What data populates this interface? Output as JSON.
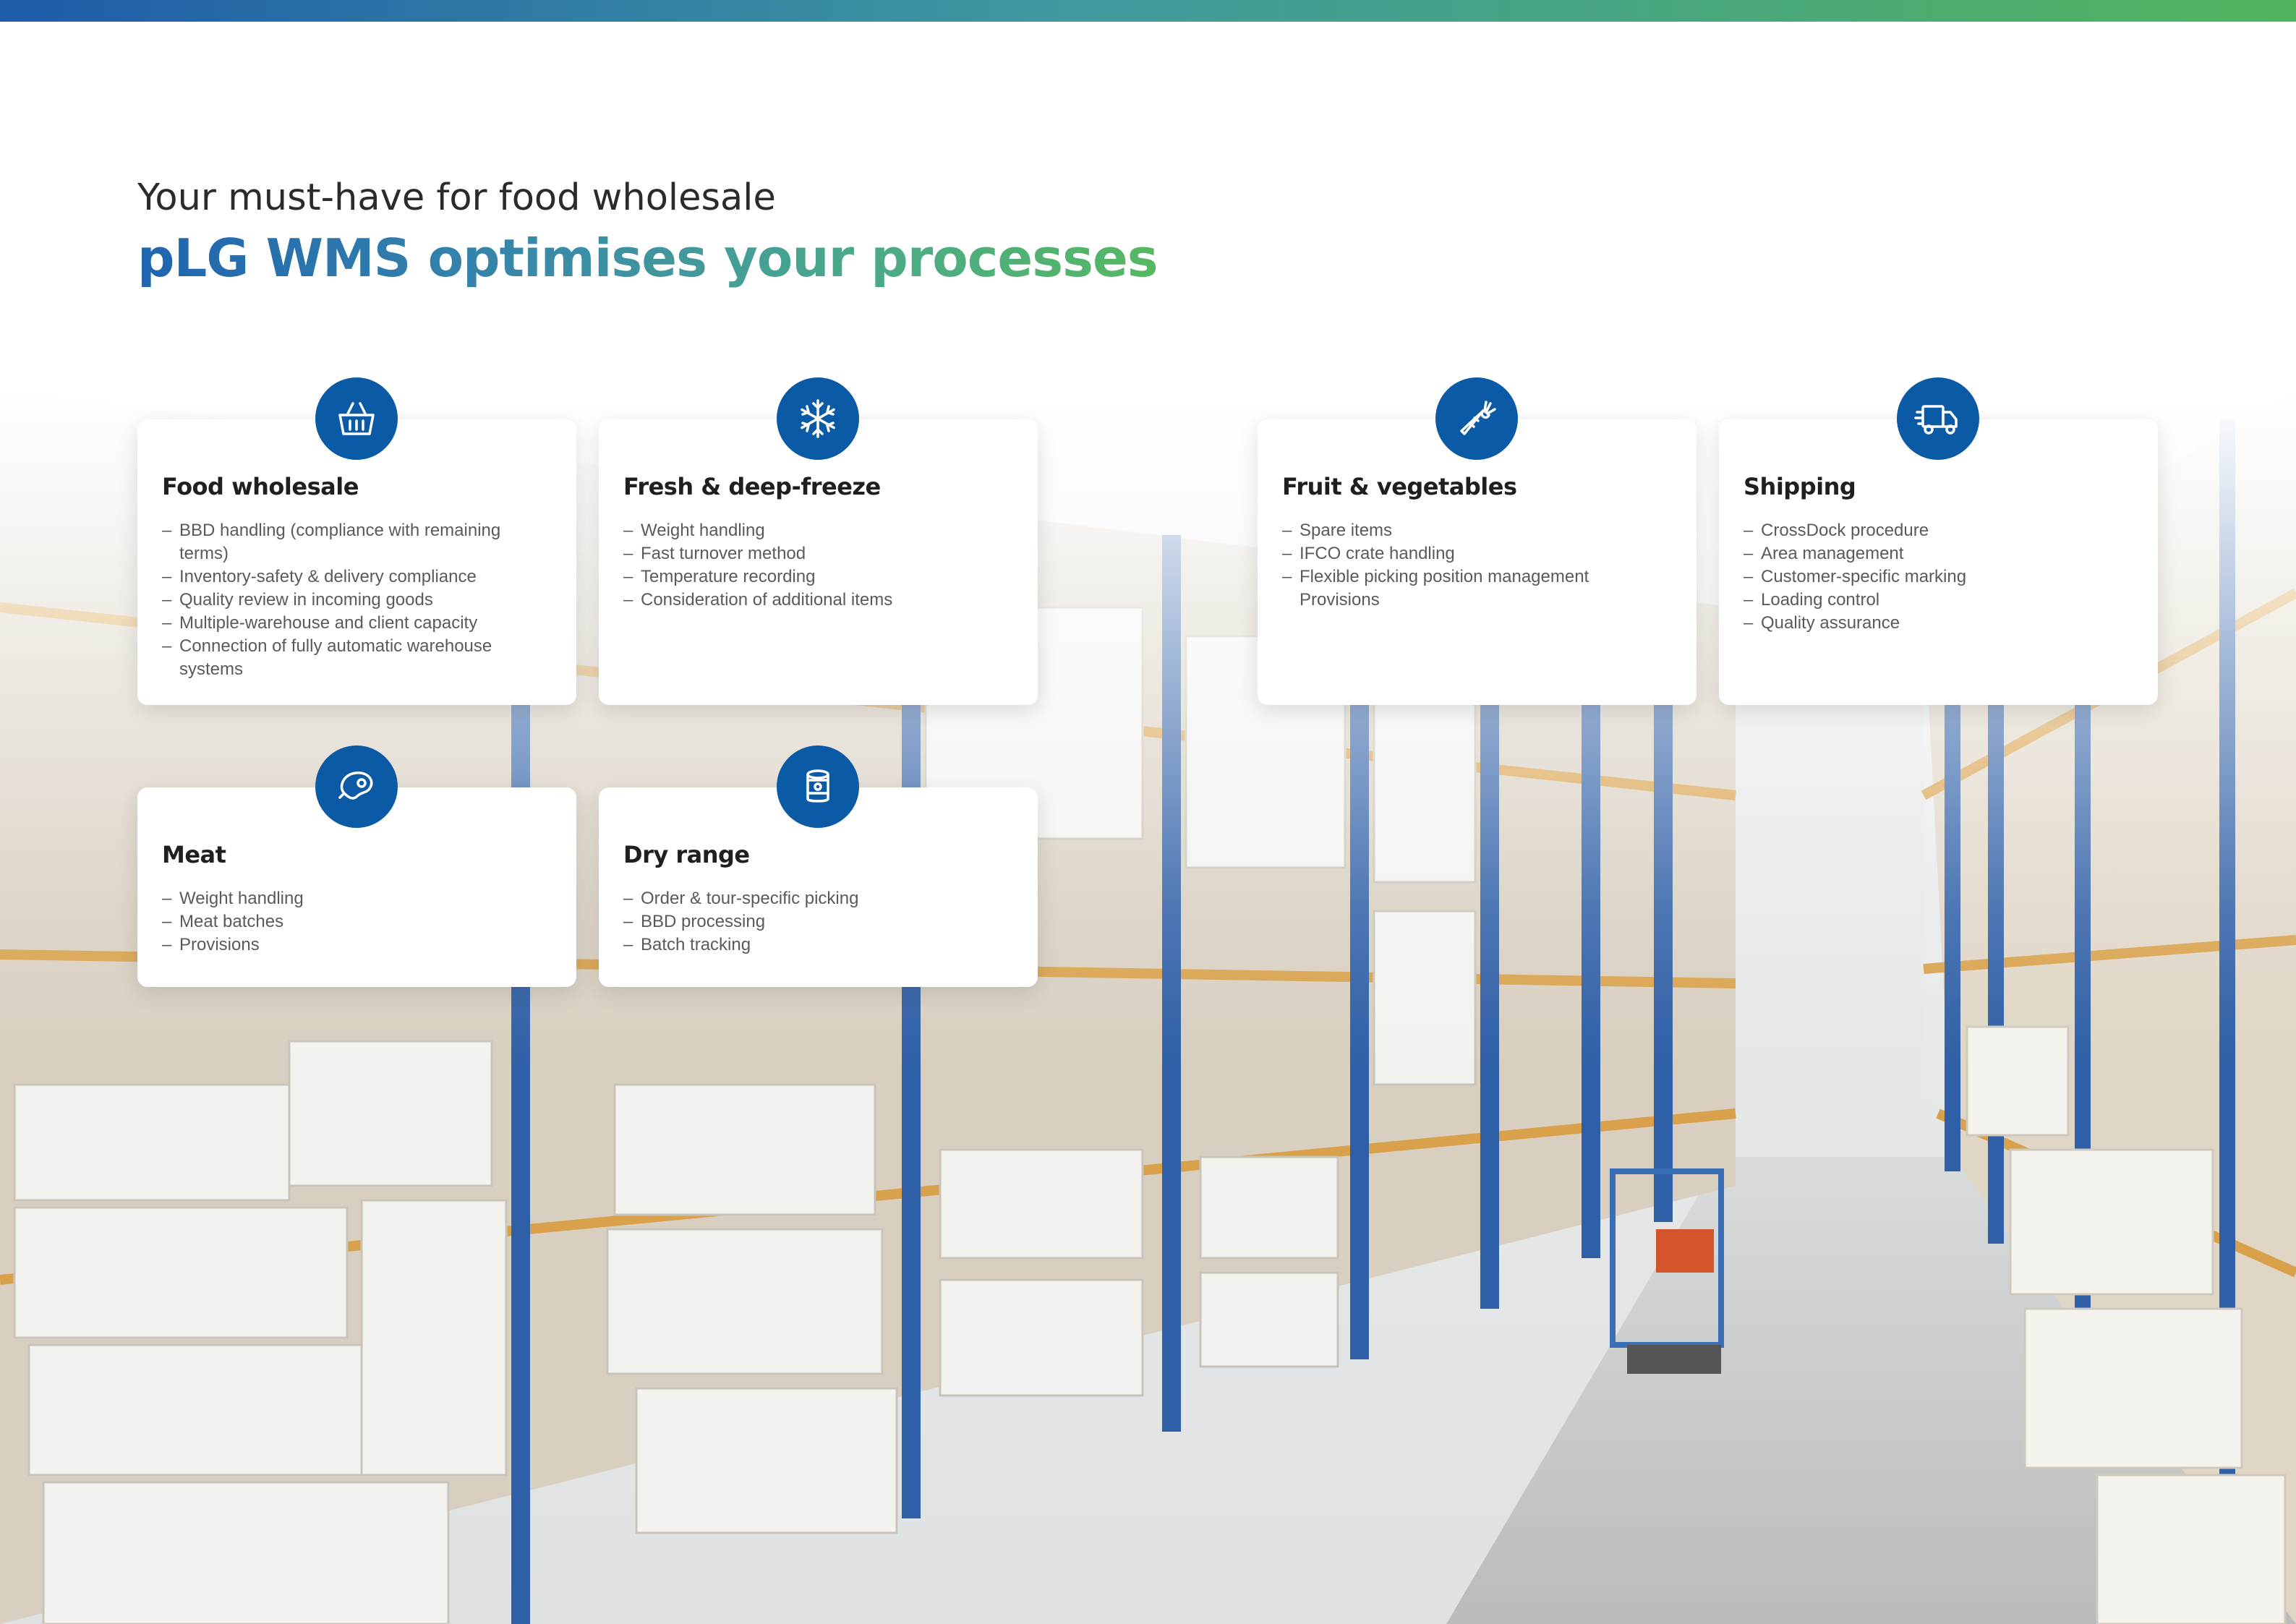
{
  "header": {
    "subtitle": "Your must-have for food wholesale",
    "title": "pLG WMS optimises your processes"
  },
  "cards": [
    {
      "icon": "basket-icon",
      "title": "Food wholesale",
      "items": [
        "BBD handling (compliance with remaining terms)",
        "Inventory-safety & delivery compliance",
        "Quality review in incoming goods",
        "Multiple-warehouse and client capacity",
        "Connection of fully automatic warehouse systems"
      ]
    },
    {
      "icon": "snowflake-icon",
      "title": "Fresh & deep-freeze",
      "items": [
        "Weight handling",
        "Fast turnover method",
        "Temperature recording",
        "Consideration of additional items"
      ]
    },
    {
      "icon": "carrot-icon",
      "title": "Fruit & vegetables",
      "items": [
        "Spare items",
        "IFCO crate handling",
        "Flexible picking position management Provisions"
      ]
    },
    {
      "icon": "truck-icon",
      "title": "Shipping",
      "items": [
        "CrossDock procedure",
        "Area management",
        "Customer-specific marking",
        "Loading control",
        "Quality assurance"
      ]
    },
    {
      "icon": "meat-icon",
      "title": "Meat",
      "items": [
        "Weight handling",
        "Meat batches",
        "Provisions"
      ]
    },
    {
      "icon": "can-icon",
      "title": "Dry range",
      "items": [
        "Order & tour-specific picking",
        "BBD processing",
        "Batch tracking"
      ]
    }
  ]
}
